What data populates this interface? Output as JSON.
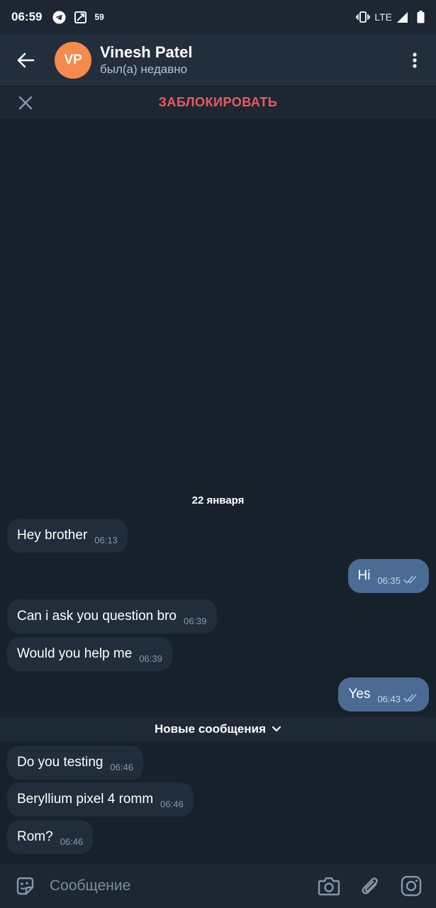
{
  "status_bar": {
    "time": "06:59",
    "notification_count": "59",
    "network": "LTE",
    "icons": [
      "telegram-icon",
      "screen-share-icon",
      "vibrate-icon",
      "signal-icon",
      "battery-icon"
    ]
  },
  "header": {
    "avatar_initials": "VP",
    "avatar_color": "#f48a4e",
    "name": "Vinesh Patel",
    "status": "был(а) недавно"
  },
  "block_bar": {
    "label": "ЗАБЛОКИРОВАТЬ",
    "label_color": "#ea5a5f"
  },
  "chat": {
    "date_separator": "22 января",
    "new_messages_label": "Новые сообщения",
    "messages_before": [
      {
        "direction": "in",
        "text": "Hey brother",
        "time": "06:13"
      },
      {
        "direction": "out",
        "text": "Hi",
        "time": "06:35",
        "read": true
      },
      {
        "direction": "in",
        "text": "Can i ask you question bro",
        "time": "06:39"
      },
      {
        "direction": "in",
        "text": "Would you help me",
        "time": "06:39"
      },
      {
        "direction": "out",
        "text": "Yes",
        "time": "06:43",
        "read": true
      }
    ],
    "messages_after": [
      {
        "direction": "in",
        "text": "Do you testing",
        "time": "06:46"
      },
      {
        "direction": "in",
        "text": "Beryllium pixel 4 romm",
        "time": "06:46"
      },
      {
        "direction": "in",
        "text": "Rom?",
        "time": "06:46"
      }
    ]
  },
  "input": {
    "placeholder": "Сообщение",
    "value": ""
  },
  "colors": {
    "background": "#17212b",
    "incoming_bubble": "#212d3b",
    "outgoing_bubble": "#4b6b94",
    "header": "#232e3c"
  }
}
